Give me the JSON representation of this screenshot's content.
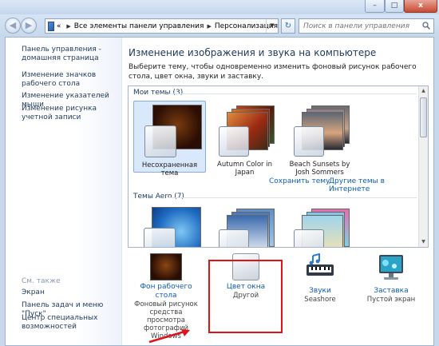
{
  "window": {
    "title_controls": {
      "minimize": "–",
      "maximize": "□",
      "close": "x"
    }
  },
  "address": {
    "separator": "«",
    "crumbs": [
      "Все элементы панели управления",
      "Персонализация"
    ]
  },
  "search": {
    "placeholder": "Поиск в панели управления"
  },
  "sidebar": {
    "links": [
      "Панель управления - домашняя страница",
      "Изменение значков рабочего стола",
      "Изменение указателей мыши",
      "Изменение рисунка учетной записи"
    ],
    "see_also_title": "См. также",
    "see_also": [
      "Экран",
      "Панель задач и меню \"Пуск\"",
      "Центр специальных возможностей"
    ]
  },
  "main": {
    "heading": "Изменение изображения и звука на компьютере",
    "description": "Выберите тему, чтобы одновременно изменить фоновый рисунок рабочего стола, цвет окна, звуки и заставку.",
    "groups": {
      "my_themes": "Мои темы (3)",
      "aero_themes": "Темы Aero (7)"
    },
    "my_themes": [
      {
        "label": "Несохраненная тема",
        "selected": true
      },
      {
        "label": "Autumn Color in Japan",
        "selected": false
      },
      {
        "label": "Beach Sunsets by Josh Sommers",
        "selected": false
      }
    ],
    "save_theme": "Сохранить тему",
    "more_themes": "Другие темы в Интернете"
  },
  "settings": [
    {
      "title": "Фон рабочего стола",
      "sub": "Фоновый рисунок средства просмотра фотографий Windows",
      "icon": "desktop-background-icon"
    },
    {
      "title": "Цвет окна",
      "sub": "Другой",
      "icon": "window-color-icon"
    },
    {
      "title": "Звуки",
      "sub": "Seashore",
      "icon": "sounds-icon"
    },
    {
      "title": "Заставка",
      "sub": "Пустой экран",
      "icon": "screensaver-icon"
    }
  ],
  "colors": {
    "link": "#0e5bb8",
    "highlight": "#e0131a",
    "selected_theme_bg": "#d9e8fb"
  }
}
